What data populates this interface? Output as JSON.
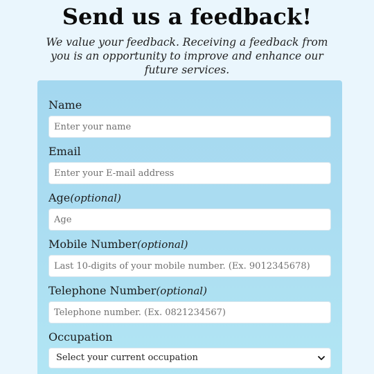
{
  "header": {
    "title": "Send us a feedback!",
    "subtitle": "We value your feedback. Receiving a feedback from you is an opportunity to improve and enhance our future services."
  },
  "form": {
    "name": {
      "label": "Name",
      "placeholder": "Enter your name"
    },
    "email": {
      "label": "Email",
      "placeholder": "Enter your E-mail address"
    },
    "age": {
      "label": "Age",
      "optional": "(optional)",
      "placeholder": "Age"
    },
    "mobile": {
      "label": "Mobile Number",
      "optional": "(optional)",
      "placeholder": "Last 10-digits of your mobile number. (Ex. 9012345678)"
    },
    "telephone": {
      "label": "Telephone Number",
      "optional": "(optional)",
      "placeholder": "Telephone number. (Ex. 0821234567)"
    },
    "occupation": {
      "label": "Occupation",
      "selected": "Select your current occupation"
    }
  }
}
